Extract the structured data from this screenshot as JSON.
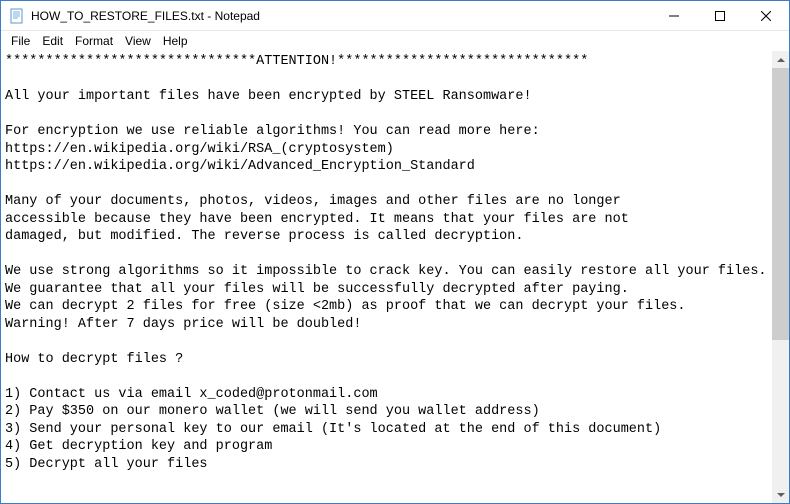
{
  "window": {
    "title": "HOW_TO_RESTORE_FILES.txt - Notepad"
  },
  "menu": {
    "file": "File",
    "edit": "Edit",
    "format": "Format",
    "view": "View",
    "help": "Help"
  },
  "document": {
    "line1": "*******************************ATTENTION!*******************************",
    "line2": "",
    "line3": "All your important files have been encrypted by STEEL Ransomware!",
    "line4": "",
    "line5": "For encryption we use reliable algorithms! You can read more here:",
    "line6": "https://en.wikipedia.org/wiki/RSA_(cryptosystem)",
    "line7": "https://en.wikipedia.org/wiki/Advanced_Encryption_Standard",
    "line8": "",
    "line9": "Many of your documents, photos, videos, images and other files are no longer",
    "line10": "accessible because they have been encrypted. It means that your files are not",
    "line11": "damaged, but modified. The reverse process is called decryption.",
    "line12": "",
    "line13": "We use strong algorithms so it impossible to crack key. You can easily restore all your files.",
    "line14": "We guarantee that all your files will be successfully decrypted after paying.",
    "line15": "We can decrypt 2 files for free (size <2mb) as proof that we can decrypt your files.",
    "line16": "Warning! After 7 days price will be doubled!",
    "line17": "",
    "line18": "How to decrypt files ?",
    "line19": "",
    "line20": "1) Contact us via email x_coded@protonmail.com",
    "line21": "2) Pay $350 on our monero wallet (we will send you wallet address)",
    "line22": "3) Send your personal key to our email (It's located at the end of this document)",
    "line23": "4) Get decryption key and program",
    "line24": "5) Decrypt all your files"
  }
}
